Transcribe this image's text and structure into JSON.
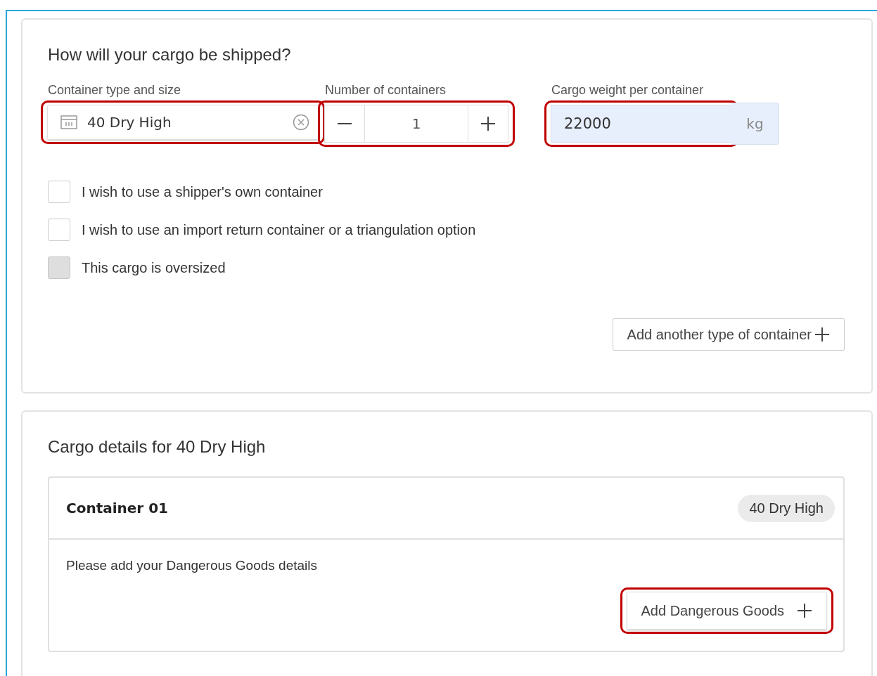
{
  "shipping": {
    "title": "How will your cargo be shipped?",
    "fields": [
      {
        "kind": "select",
        "label": "Container type and size",
        "value": "40 Dry High",
        "highlighted": true
      },
      {
        "kind": "stepper",
        "label": "Number of containers",
        "value": "1",
        "highlighted": true
      },
      {
        "kind": "unit",
        "label": "Cargo weight per container",
        "value": "22000",
        "unit": "kg",
        "highlighted": true
      }
    ],
    "options": [
      {
        "label": "I wish to use a shipper's own container",
        "checked": false,
        "disabled": false
      },
      {
        "label": "I wish to use an import return container or a triangulation option",
        "checked": false,
        "disabled": false
      },
      {
        "label": "This cargo is oversized",
        "checked": false,
        "disabled": true
      }
    ],
    "add_button": {
      "label": "Add another type of container"
    }
  },
  "details": {
    "title": "Cargo details for 40 Dry High",
    "containers": [
      {
        "name": "Container 01",
        "tag": "40 Dry High",
        "message": "Please add your Dangerous Goods details",
        "button": {
          "label": "Add Dangerous Goods",
          "highlighted": true
        }
      }
    ]
  }
}
